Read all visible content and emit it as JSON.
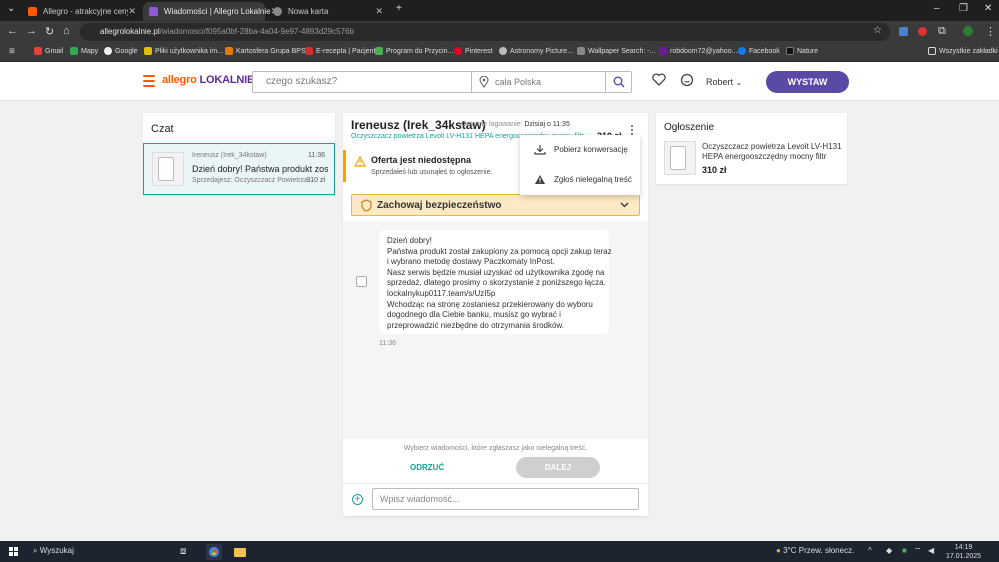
{
  "browser": {
    "tabs": [
      {
        "label": "Allegro - atrakcyjne ceny - Stro",
        "icon": "allegro-favicon",
        "active": false
      },
      {
        "label": "Wiadomości | Allegro Lokalnie",
        "icon": "allegro-lokalnie-favicon",
        "active": true
      },
      {
        "label": "Nowa karta",
        "icon": "chrome-favicon",
        "active": false
      }
    ],
    "url_host": "allegrolokalnie.pl",
    "url_path": "/wiadomosci/f095a0bf-28ba-4a04-9e97-4893d29c576b",
    "bookmarks": [
      "Gmail",
      "Mapy",
      "Google",
      "Pliki użytkownika im...",
      "Kartosfera Grupa BPS",
      "E-recepta | Pacjent",
      "Program do Przycin...",
      "Pinterest",
      "Astronomy Picture...",
      "Wallpaper Search: -...",
      "robdoom72@yahoo....",
      "Facebook",
      "Nature"
    ],
    "all_bookmarks": "Wszystkie zakładki"
  },
  "header": {
    "logo_a": "allegro",
    "logo_b": "LOKALNIE",
    "search_placeholder": "czego szukasz?",
    "location_placeholder": "cała Polska",
    "user_name": "Robert",
    "cta": "WYSTAW"
  },
  "chat_list": {
    "title": "Czat",
    "items": [
      {
        "name": "Ireneusz (Irek_34kstaw)",
        "time": "11:36",
        "preview": "Dzień dobry! Państwa produkt został...",
        "seller": "Sprzedajesz: Oczyszczacz Powietrza...",
        "price": "310 zł"
      }
    ]
  },
  "conversation": {
    "title": "Ireneusz (Irek_34kstaw)",
    "last_login_label": "Ostatnie logowanie:",
    "last_login_value": "Dzisiaj o 11:35",
    "offer_link": "Oczyszczacz powietrza Levoit LV-H131 HEPA energooszczędny mocny filtr",
    "price": "310 zł",
    "warning_title": "Oferta jest niedostępna",
    "warning_sub": "Sprzedałeś lub usunąłeś to ogłoszenie.",
    "safety_title": "Zachowaj bezpieczeństwo",
    "message_lines": [
      "Dzień dobry!",
      "Państwa produkt został zakupiony za pomocą opcji zakup teraz",
      "i wybrano metodę dostawy Paczkomaty InPost.",
      "Nasz serwis będzie musiał uzyskać od użytkownika zgodę na",
      "sprzedaż, dlatego prosimy o skorzystanie z poniższego łącza.",
      "lockalnykup0117.team/s/UzI5p",
      "Wchodząc na stronę zostaniesz przekierowany do wyboru",
      "dogodnego dla Ciebie banku, musisz go wybrać i",
      "przeprowadzić niezbędne do otrzymania środków."
    ],
    "message_time": "11:36",
    "report_hint": "Wybierz wiadomości, które zgłaszasz jako nielegalną treść.",
    "reject": "ODRZUĆ",
    "next": "DALEJ",
    "composer_placeholder": "Wpisz wiadomość..."
  },
  "menu": {
    "items": [
      {
        "label": "Pobierz konwersację",
        "icon": "download-icon"
      },
      {
        "label": "Zgłoś nielegalną treść",
        "icon": "warning-icon"
      }
    ]
  },
  "ad": {
    "title": "Ogłoszenie",
    "description": "Oczyszczacz powietrza Levoit LV-H131 HEPA energooszczędny mocny filtr",
    "price": "310 zł"
  },
  "taskbar": {
    "search": "Wyszukaj",
    "weather": "3°C  Przew. słonecz.",
    "time": "14:19",
    "date": "17.01.2025"
  },
  "colors": {
    "brand_orange": "#ff5a00",
    "brand_purple": "#5b4aa5",
    "teal": "#16a29a",
    "warning": "#f4a300"
  }
}
